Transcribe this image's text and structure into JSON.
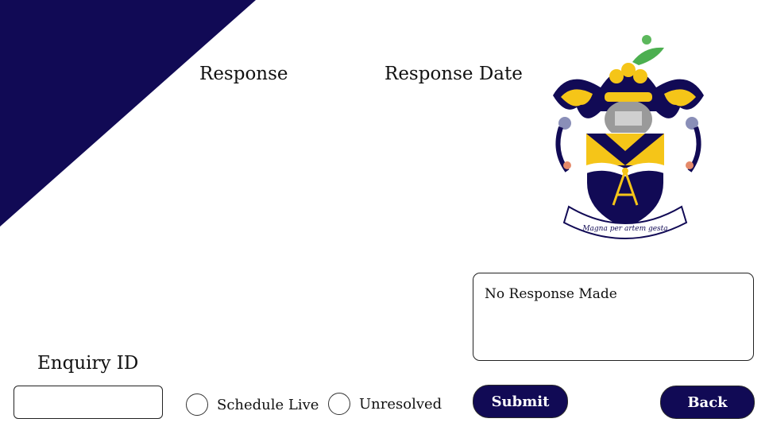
{
  "header": {
    "response_label": "Response",
    "response_date_label": "Response Date"
  },
  "crest": {
    "motto": "Magna per artem gesta"
  },
  "response_box": {
    "text": "No Response Made"
  },
  "enquiry": {
    "label": "Enquiry ID",
    "value": ""
  },
  "options": {
    "schedule_live_label": "Schedule Live",
    "unresolved_label": "Unresolved"
  },
  "buttons": {
    "submit_label": "Submit",
    "back_label": "Back"
  },
  "colors": {
    "brand_navy": "#110a55",
    "crest_gold": "#f5c518"
  }
}
